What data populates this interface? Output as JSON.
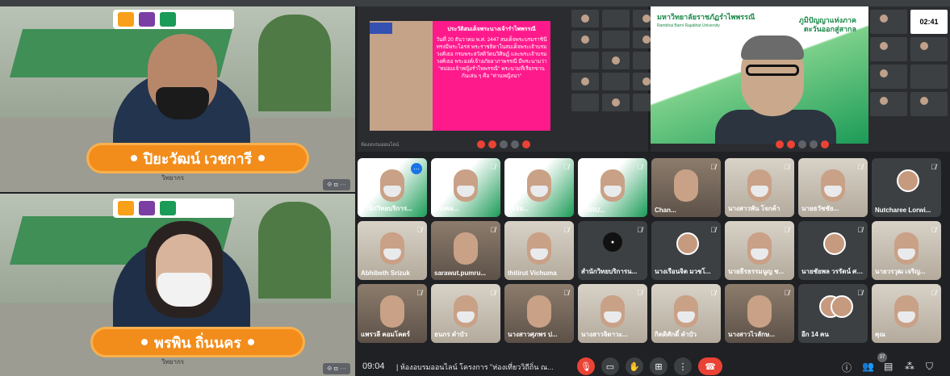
{
  "speakers": {
    "top": {
      "name": "ปิยะวัฒน์ เวชการี",
      "role": "วิทยากร",
      "badge": "⟐ ⊡ ⋯"
    },
    "bottom": {
      "name": "พรพิน ถิ่นนคร",
      "role": "วิทยากร",
      "badge": "⟐ ⊡ ⋯"
    }
  },
  "shared_left": {
    "slide_title": "ประวัติสมเด็จพระนางเจ้ารำไพพรรณี",
    "slide_body": "วันที่ 20 ธันวาคม พ.ศ. 2447 สมเด็จพระบรมราชินีทรงมีพระโอรส พระราชธิดาในสมเด็จพระเจ้าบรมวงศ์เธอ กรมพระสวัสดิวัดนวิศิษฏ์ และพระเจ้าบรมวงศ์เธอ พระองค์เจ้าอภัยอาภาพรรณี มีพระนามว่า \"หม่อมเจ้าหญิงรำไพพรรณี\" พระนามที่เรียกขานกันเล่น ๆ คือ \"ท่านหญิงนา\"",
    "strip_label": "ห้องอบรมออนไลน์"
  },
  "shared_right": {
    "uni_name": "มหาวิทยาลัยราชภัฏรำไพพรรณี",
    "uni_sub": "Rambhai Barni Rajabhat University",
    "slogan": "ภูมิปัญญาแห่งภาคตะวันออกสู่สากล",
    "clock": "02:41"
  },
  "participants": [
    {
      "name": "สำนักวิทยบริการ...",
      "style": "green",
      "highlight": true
    },
    {
      "name": "ทรงพล...",
      "style": "green"
    },
    {
      "name": "สุรชัย...",
      "style": "green"
    },
    {
      "name": "RBRU...",
      "style": "green"
    },
    {
      "name": "Chan...",
      "style": "room"
    },
    {
      "name": "นางสาวพัน โจกค้า",
      "style": "light"
    },
    {
      "name": "นายธวัชชัย...",
      "style": "light"
    },
    {
      "name": "Nutcharee Lorwi...",
      "style": "dark-avatar"
    },
    {
      "name": "Abhibeth Srizuk",
      "style": "light"
    },
    {
      "name": "sarawut.pumru...",
      "style": "room"
    },
    {
      "name": "thitirut Vichuma",
      "style": "light"
    },
    {
      "name": "สำนักวิทยบริการน...",
      "style": "dark-logo"
    },
    {
      "name": "นางเรือนจิต มวชโ...",
      "style": "dark-avatar"
    },
    {
      "name": "นายธีรธรรมนูญ ช...",
      "style": "light"
    },
    {
      "name": "นายชัยพล วรรัตน์ ศรีสุ...",
      "style": "dark-avatar"
    },
    {
      "name": "นายวรวุฒ เจริญ...",
      "style": "light"
    },
    {
      "name": "แพรวลี คอมโคตร์",
      "style": "room"
    },
    {
      "name": "ธนกร คำบัว",
      "style": "light"
    },
    {
      "name": "นางสาวศุภพร ป...",
      "style": "room"
    },
    {
      "name": "นางสาวจิดาวะ...",
      "style": "light"
    },
    {
      "name": "กิตติศักดิ์ คำบัว",
      "style": "light"
    },
    {
      "name": "นางสาวไวลักษ...",
      "style": "room"
    },
    {
      "name": "อีก 14 คน",
      "style": "more"
    },
    {
      "name": "คุณ",
      "style": "light"
    }
  ],
  "bottom_bar": {
    "time": "09:04",
    "title": "ห้องอบรมออนไลน์ โครงการ \"ห่องเที่ยววิถีถิ่น ณ...",
    "people_count": "37"
  },
  "colors": {
    "accent": "#f28c1b",
    "end_call": "#ea4335",
    "slide_pink": "#ff1a8c"
  }
}
